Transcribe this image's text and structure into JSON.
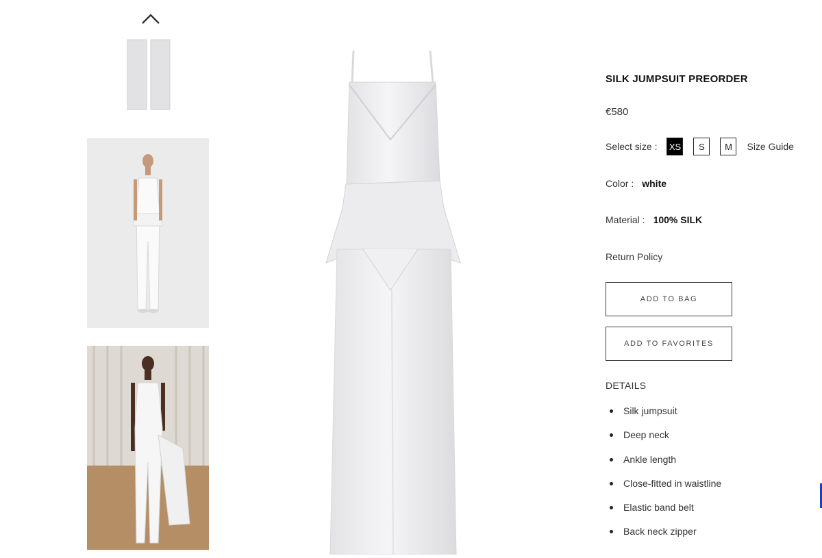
{
  "gallery": {
    "up_icon": "chevron-up-icon",
    "thumbnails": [
      {
        "kind": "flat-lay"
      },
      {
        "kind": "model-front"
      },
      {
        "kind": "runway"
      }
    ]
  },
  "product": {
    "title": "SILK JUMPSUIT PREORDER",
    "price": "€580",
    "size_label": "Select size :",
    "sizes": [
      "XS",
      "S",
      "M"
    ],
    "selected_size": "XS",
    "size_guide": "Size Guide",
    "color_label": "Color :",
    "color_value": "white",
    "material_label": "Material :",
    "material_value": "100% SILK",
    "return_policy": "Return Policy",
    "add_to_bag": "ADD TO BAG",
    "add_to_favorites": "ADD TO FAVORITES",
    "details_heading": "DETAILS",
    "details": [
      "Silk jumpsuit",
      "Deep neck",
      "Ankle length",
      "Close-fitted in waistline",
      "Elastic band belt",
      "Back neck zipper"
    ]
  },
  "colors": {
    "text": "#222222",
    "selected_size_bg": "#000000",
    "garment": "#e8e8ea",
    "edge_accent": "#1a3fc4"
  }
}
